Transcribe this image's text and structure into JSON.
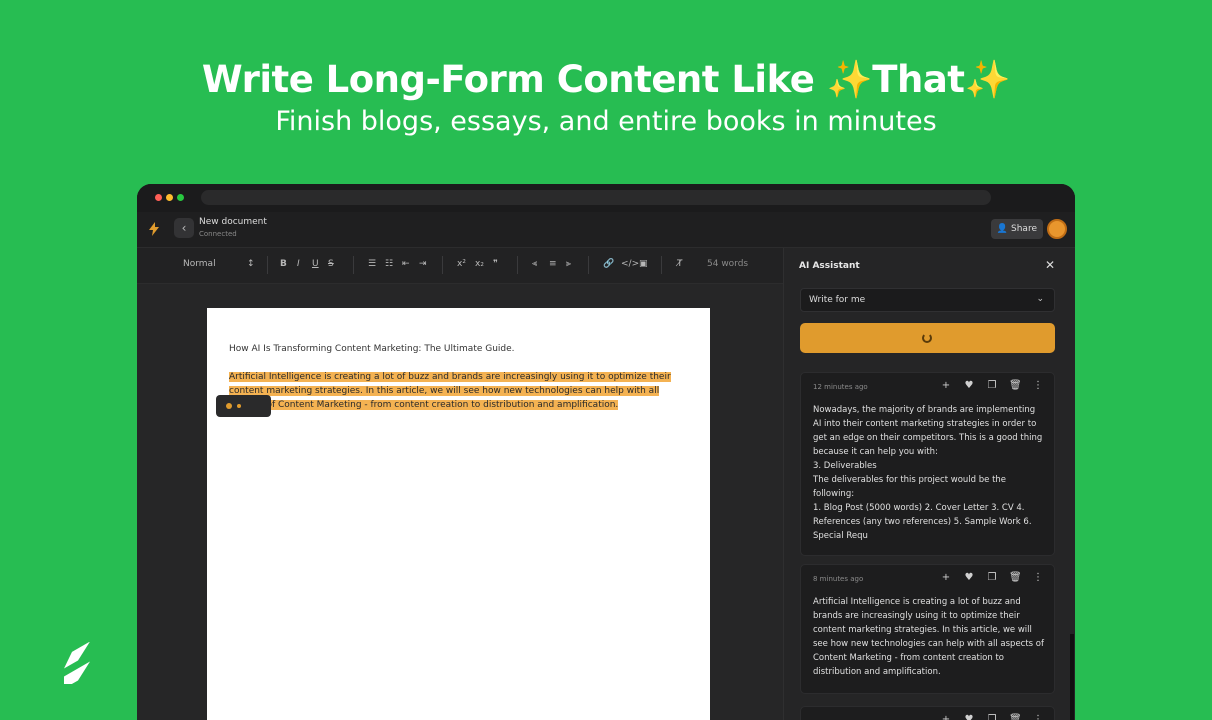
{
  "hero": {
    "headline": "Write Long-Form Content Like ✨That✨",
    "subheadline": "Finish blogs, essays, and entire books in minutes"
  },
  "colors": {
    "background": "#27bd52",
    "accent": "#e09b2d",
    "highlight": "#f4b252",
    "window": "#1b1b1c"
  },
  "header": {
    "doc_title": "New document",
    "doc_status": "Connected",
    "share_label": "Share",
    "back_icon": "chevron-left-icon"
  },
  "toolbar": {
    "paragraph_style": "Normal",
    "word_count": "54 words"
  },
  "document": {
    "title": "How AI Is Transforming Content Marketing: The Ultimate Guide.",
    "body": "Artificial Intelligence is creating a lot of buzz and brands are increasingly using it to optimize their content marketing strategies. In this article, we will see how new technologies can help with all aspects of Content Marketing - from content creation to distribution and amplification."
  },
  "assistant": {
    "title": "AI Assistant",
    "mode_selected": "Write for me",
    "results": [
      {
        "time": "12 minutes ago",
        "text": "Nowadays, the majority of brands are implementing AI into their content marketing strategies in order to get an edge on their competitors. This is a good thing because it can help you with:\n3. Deliverables\nThe deliverables for this project would be the following:\n1. Blog Post (5000 words) 2. Cover Letter 3. CV 4. References (any two references) 5. Sample Work 6. Special Requ"
      },
      {
        "time": "8 minutes ago",
        "text": "Artificial Intelligence is creating a lot of buzz and brands are increasingly using it to optimize their content marketing strategies. In this article, we will see how new technologies can help with all aspects of Content Marketing - from content creation to distribution and amplification."
      }
    ]
  }
}
